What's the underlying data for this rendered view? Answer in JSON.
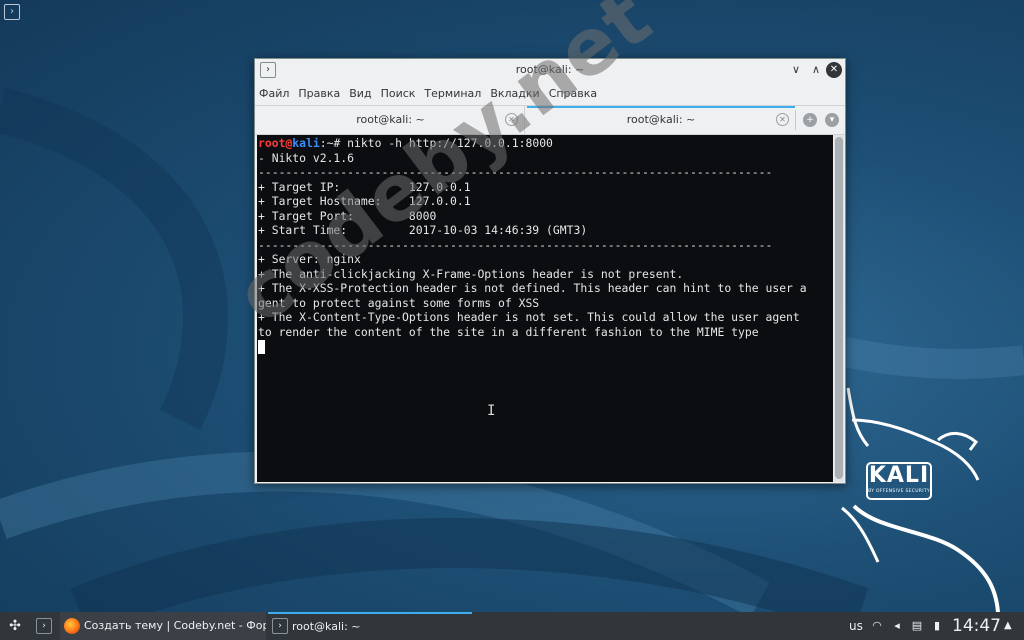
{
  "window": {
    "title": "root@kali: ~",
    "menu": [
      "Файл",
      "Правка",
      "Вид",
      "Поиск",
      "Терминал",
      "Вкладки",
      "Справка"
    ],
    "tabs": [
      {
        "label": "root@kali: ~"
      },
      {
        "label": "root@kali: ~"
      }
    ]
  },
  "terminal": {
    "prompt_user": "root@kali",
    "prompt_rest": ":~# ",
    "command": "nikto -h http://127.0.0.1:8000",
    "output": [
      "- Nikto v2.1.6",
      "---------------------------------------------------------------------------",
      "+ Target IP:          127.0.0.1",
      "+ Target Hostname:    127.0.0.1",
      "+ Target Port:        8000",
      "+ Start Time:         2017-10-03 14:46:39 (GMT3)",
      "---------------------------------------------------------------------------",
      "+ Server: nginx",
      "+ The anti-clickjacking X-Frame-Options header is not present.",
      "+ The X-XSS-Protection header is not defined. This header can hint to the user a",
      "gent to protect against some forms of XSS",
      "+ The X-Content-Type-Options header is not set. This could allow the user agent",
      "to render the content of the site in a different fashion to the MIME type"
    ]
  },
  "watermark": "codeby.net",
  "kali_logo": {
    "name": "KALI",
    "tagline": "BY OFFENSIVE SECURITY"
  },
  "taskbar": {
    "tasks": [
      {
        "label": "Создать тему | Codeby.net - Фор..."
      },
      {
        "label": "root@kali: ~"
      }
    ],
    "keyboard_layout": "us",
    "clock": "14:47"
  },
  "colors": {
    "accent": "#3daee9",
    "prompt_user": "#ff3c3c",
    "prompt_host": "#3b8ef7"
  }
}
